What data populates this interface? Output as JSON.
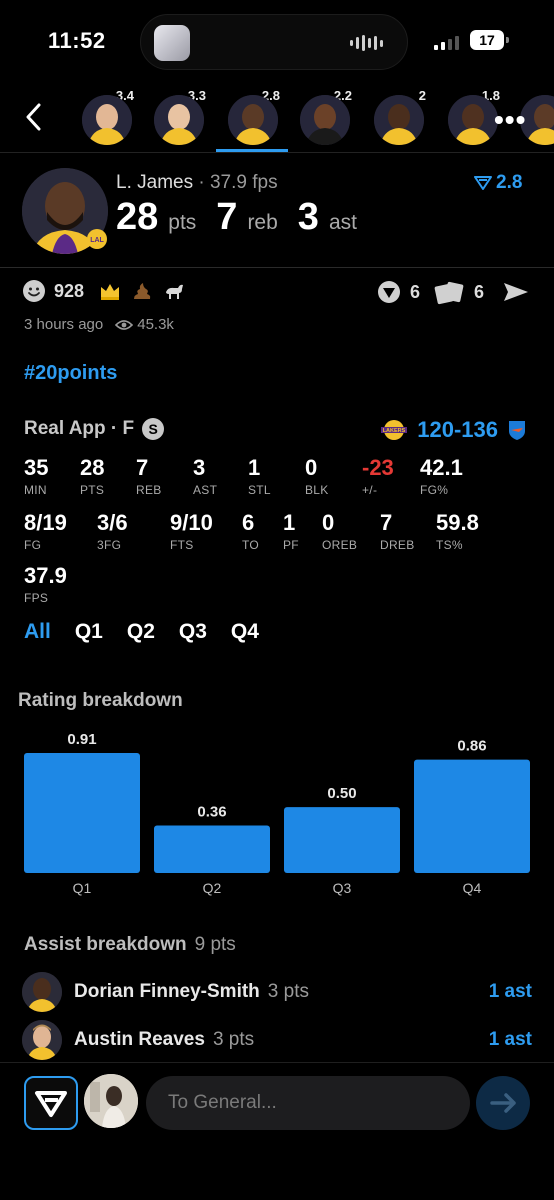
{
  "status_bar": {
    "time": "11:52",
    "battery": "17"
  },
  "player_strip": [
    {
      "rating": "3.4",
      "name": "player-1"
    },
    {
      "rating": "3.3",
      "name": "player-2"
    },
    {
      "rating": "2.8",
      "name": "player-3",
      "selected": true
    },
    {
      "rating": "2.2",
      "name": "player-4"
    },
    {
      "rating": "2",
      "name": "player-5"
    },
    {
      "rating": "1.8",
      "name": "player-6"
    },
    {
      "rating": "",
      "name": "player-7"
    }
  ],
  "player": {
    "name": "L. James",
    "fps_text": "· 37.9 fps",
    "rating": "2.8",
    "pts": "28",
    "pts_label": "pts",
    "reb": "7",
    "reb_label": "reb",
    "ast": "3",
    "ast_label": "ast"
  },
  "reactions": {
    "count": "928",
    "predictions": "6",
    "cards": "6"
  },
  "meta": {
    "time_ago": "3 hours ago",
    "views": "45.3k"
  },
  "hashtag": "#20points",
  "game": {
    "league": "Real App · F",
    "badge": "S",
    "score": "120-136"
  },
  "box_score": {
    "row1": [
      {
        "value": "35",
        "label": "MIN"
      },
      {
        "value": "28",
        "label": "PTS"
      },
      {
        "value": "7",
        "label": "REB"
      },
      {
        "value": "3",
        "label": "AST"
      },
      {
        "value": "1",
        "label": "STL"
      },
      {
        "value": "0",
        "label": "BLK"
      },
      {
        "value": "-23",
        "label": "+/-"
      },
      {
        "value": "42.1",
        "label": "FG%"
      }
    ],
    "row2": [
      {
        "value": "8/19",
        "label": "FG"
      },
      {
        "value": "3/6",
        "label": "3FG"
      },
      {
        "value": "9/10",
        "label": "FTS"
      },
      {
        "value": "6",
        "label": "TO"
      },
      {
        "value": "1",
        "label": "PF"
      },
      {
        "value": "0",
        "label": "OREB"
      },
      {
        "value": "7",
        "label": "DREB"
      },
      {
        "value": "59.8",
        "label": "TS%"
      }
    ],
    "row3": [
      {
        "value": "37.9",
        "label": "FPS"
      }
    ]
  },
  "tabs": [
    "All",
    "Q1",
    "Q2",
    "Q3",
    "Q4"
  ],
  "rating_breakdown_title": "Rating breakdown",
  "chart_data": {
    "type": "bar",
    "categories": [
      "Q1",
      "Q2",
      "Q3",
      "Q4"
    ],
    "values": [
      0.91,
      0.36,
      0.5,
      0.86
    ],
    "value_labels": [
      "0.91",
      "0.36",
      "0.50",
      "0.86"
    ],
    "title": "",
    "xlabel": "",
    "ylabel": "",
    "ylim": [
      0,
      0.91
    ],
    "bar_color": "#1e88e5"
  },
  "assist": {
    "title": "Assist breakdown",
    "total": "9 pts",
    "rows": [
      {
        "name": "Dorian Finney-Smith",
        "pts": "3 pts",
        "ast": "1 ast"
      },
      {
        "name": "Austin Reaves",
        "pts": "3 pts",
        "ast": "1 ast"
      }
    ]
  },
  "composer": {
    "placeholder": "To General..."
  },
  "colors": {
    "accent": "#2e9cf0",
    "negative": "#e53935",
    "bar": "#1e88e5"
  }
}
